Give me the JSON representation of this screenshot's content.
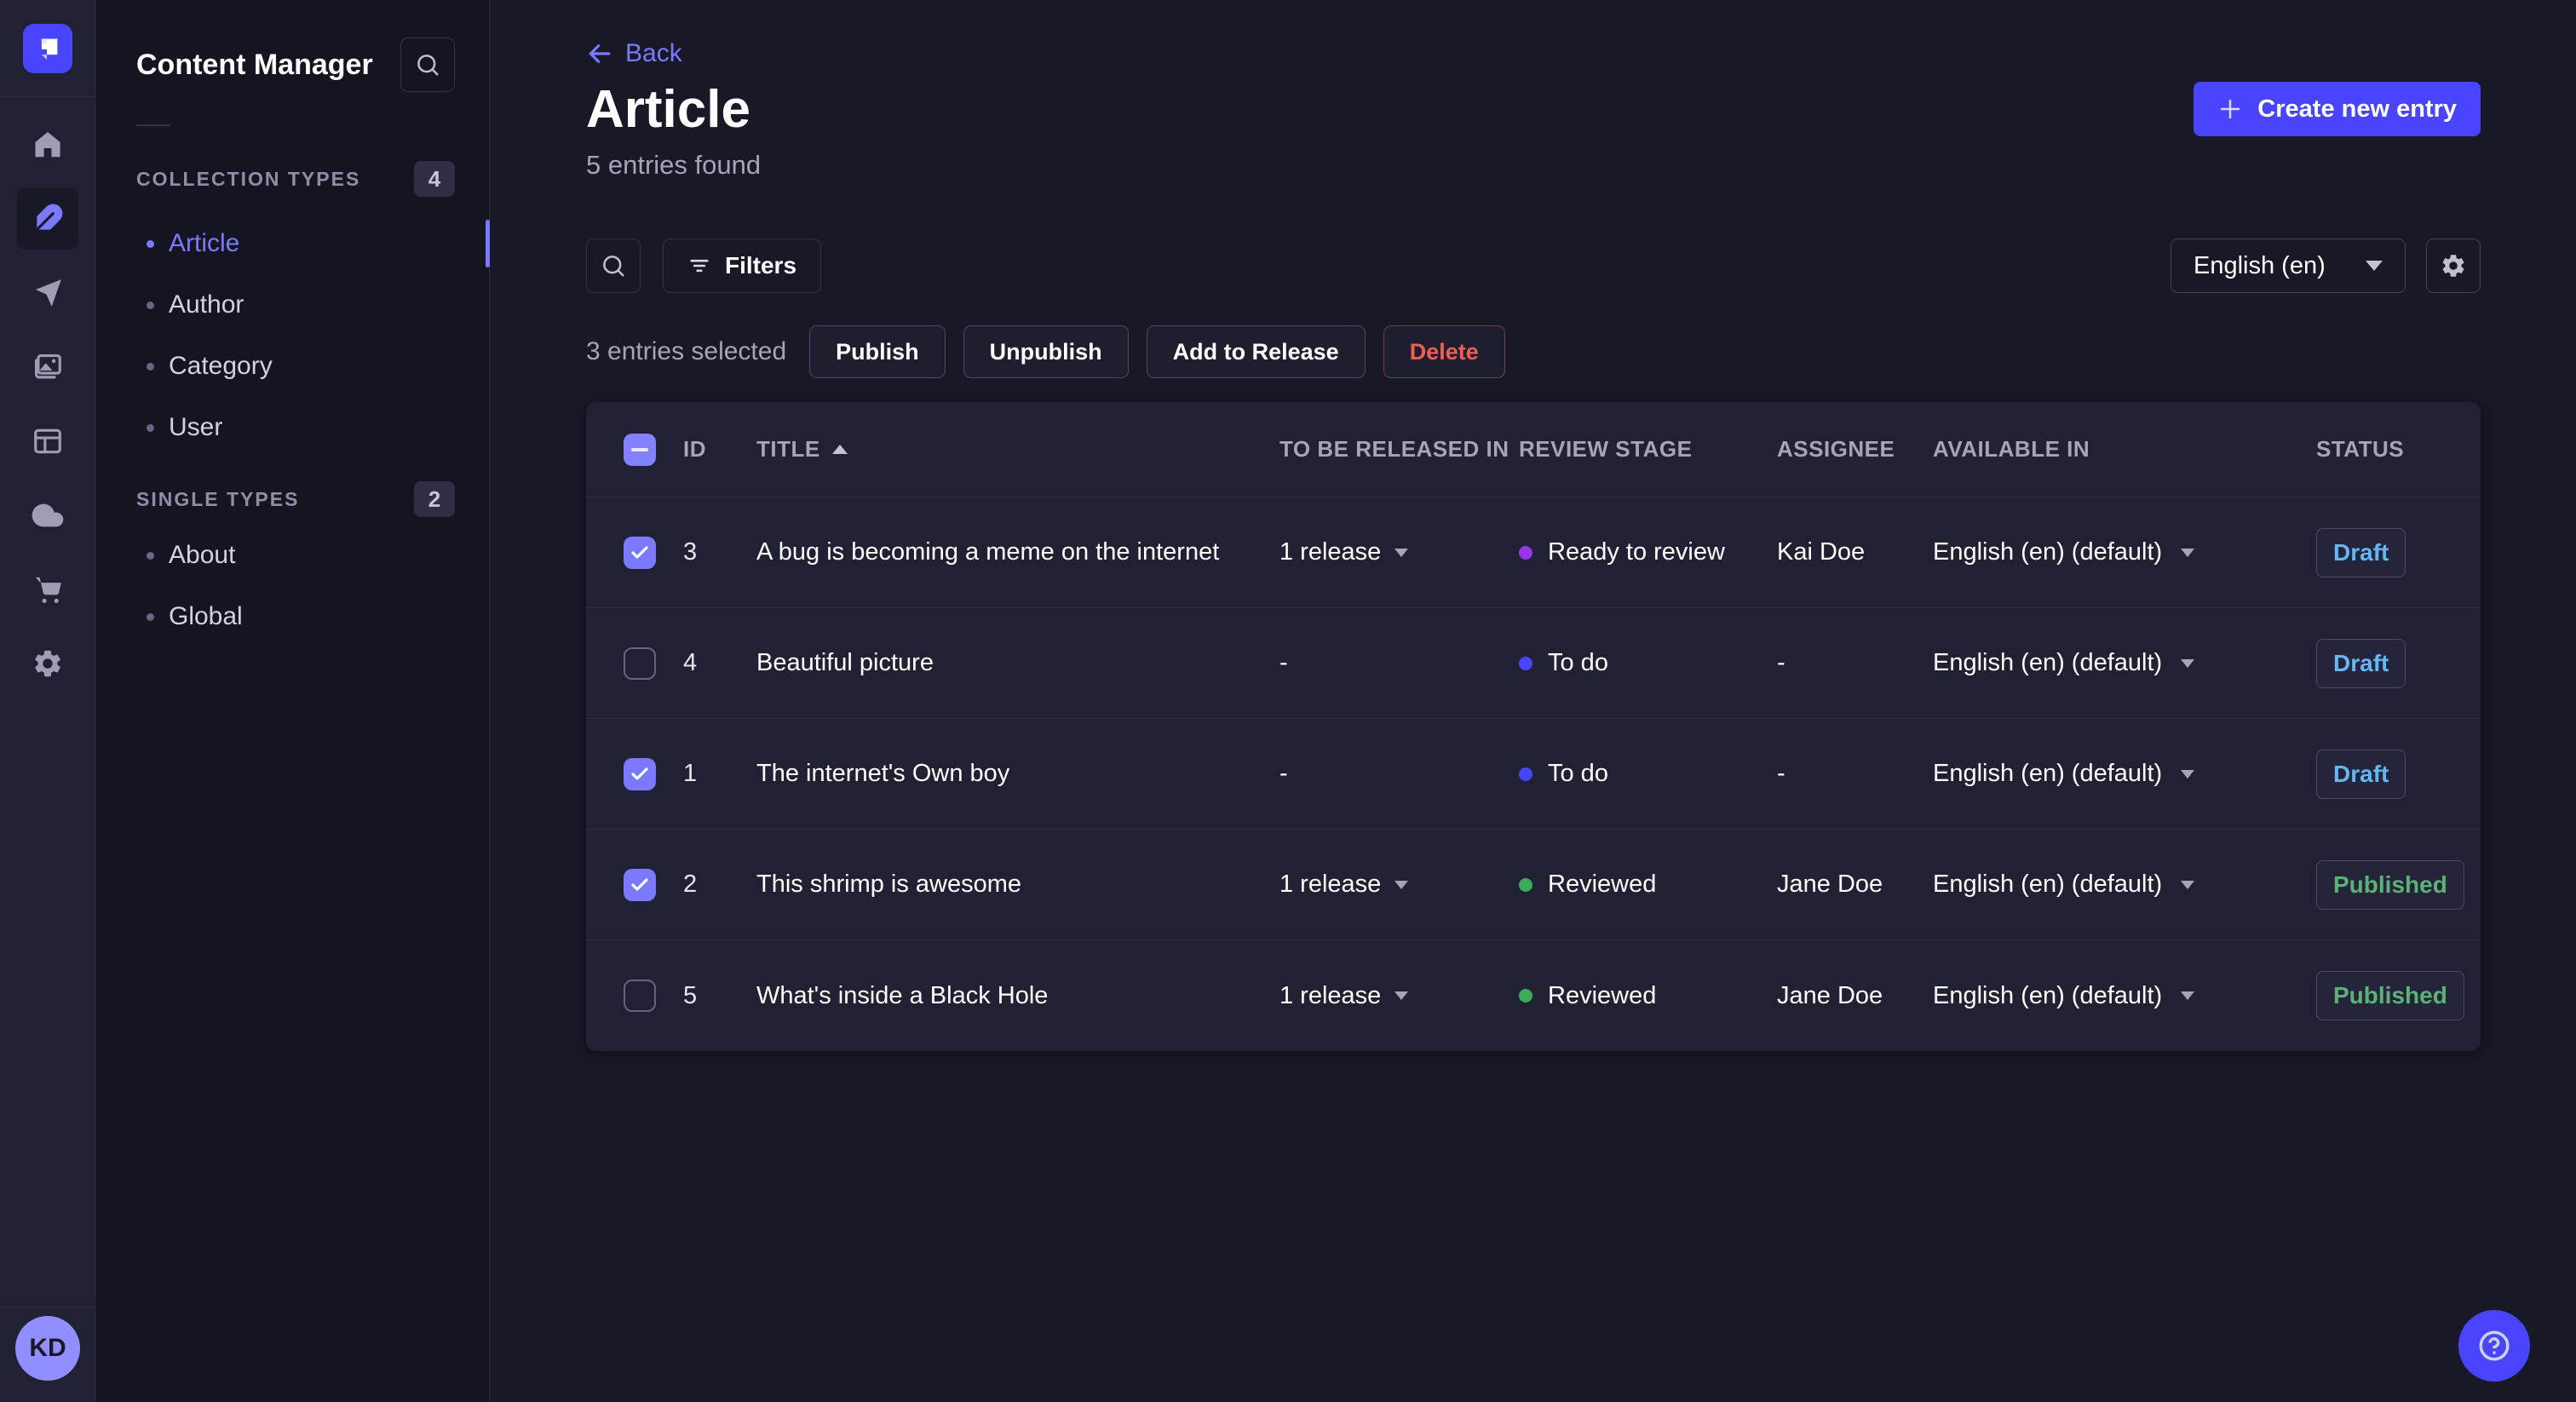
{
  "rail": {
    "logo": "strapi-logo",
    "items": [
      {
        "name": "home",
        "active": false
      },
      {
        "name": "content-manager",
        "active": true
      },
      {
        "name": "releases",
        "active": false
      },
      {
        "name": "media-library",
        "active": false
      },
      {
        "name": "content-type-builder",
        "active": false
      },
      {
        "name": "deploy",
        "active": false
      },
      {
        "name": "marketplace",
        "active": false
      },
      {
        "name": "settings",
        "active": false
      }
    ],
    "avatar_initials": "KD"
  },
  "subnav": {
    "title": "Content Manager",
    "sections": [
      {
        "label": "COLLECTION TYPES",
        "badge": "4",
        "items": [
          {
            "label": "Article",
            "active": true
          },
          {
            "label": "Author",
            "active": false
          },
          {
            "label": "Category",
            "active": false
          },
          {
            "label": "User",
            "active": false
          }
        ]
      },
      {
        "label": "SINGLE TYPES",
        "badge": "2",
        "items": [
          {
            "label": "About",
            "active": false
          },
          {
            "label": "Global",
            "active": false
          }
        ]
      }
    ]
  },
  "header": {
    "back_label": "Back",
    "title": "Article",
    "subtitle": "5 entries found",
    "create_button_label": "Create new entry"
  },
  "toolbar": {
    "filters_label": "Filters",
    "locale_selected": "English (en)"
  },
  "selection": {
    "text": "3 entries selected",
    "publish_label": "Publish",
    "unpublish_label": "Unpublish",
    "add_to_release_label": "Add to Release",
    "delete_label": "Delete"
  },
  "table": {
    "columns": [
      "ID",
      "TITLE",
      "TO BE RELEASED IN",
      "REVIEW STAGE",
      "ASSIGNEE",
      "AVAILABLE IN",
      "STATUS"
    ],
    "sort": {
      "column": "TITLE",
      "direction": "ascending"
    },
    "rows": [
      {
        "selected": true,
        "id": "3",
        "title": "A bug is becoming a meme on the internet",
        "release": "1 release",
        "stage": "Ready to review",
        "stage_color": "purple",
        "assignee": "Kai Doe",
        "locale": "English (en) (default)",
        "status": "Draft"
      },
      {
        "selected": false,
        "id": "4",
        "title": "Beautiful picture",
        "release": "-",
        "stage": "To do",
        "stage_color": "blue",
        "assignee": "-",
        "locale": "English (en) (default)",
        "status": "Draft"
      },
      {
        "selected": true,
        "id": "1",
        "title": "The internet's Own boy",
        "release": "-",
        "stage": "To do",
        "stage_color": "blue",
        "assignee": "-",
        "locale": "English (en) (default)",
        "status": "Draft"
      },
      {
        "selected": true,
        "id": "2",
        "title": "This shrimp is awesome",
        "release": "1 release",
        "stage": "Reviewed",
        "stage_color": "green",
        "assignee": "Jane Doe",
        "locale": "English (en) (default)",
        "status": "Published"
      },
      {
        "selected": false,
        "id": "5",
        "title": "What's inside a Black Hole",
        "release": "1 release",
        "stage": "Reviewed",
        "stage_color": "green",
        "assignee": "Jane Doe",
        "locale": "English (en) (default)",
        "status": "Published"
      }
    ]
  },
  "colors": {
    "primary": "#4945ff",
    "primary_light": "#7b79ff",
    "draft_text": "#66b7f1",
    "published_text": "#5cb176",
    "danger": "#ee5e52",
    "stage_purple": "#9736e8",
    "stage_blue": "#4945ff",
    "stage_green": "#3cab5a"
  }
}
